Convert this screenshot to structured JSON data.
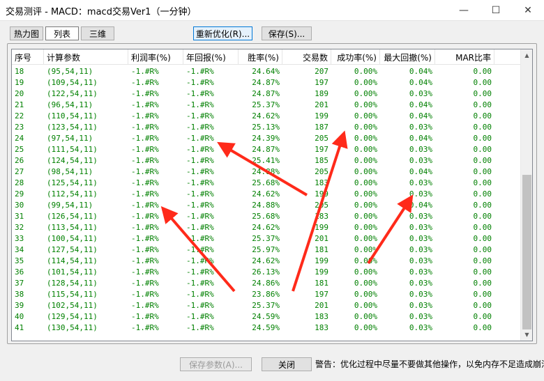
{
  "window": {
    "title": "交易测评 - MACD：macd交易Ver1（一分钟）"
  },
  "tabs": [
    "热力图",
    "列表",
    "三维"
  ],
  "toolbar": {
    "reoptimize_label": "重新优化(R)...",
    "save_label": "保存(S)..."
  },
  "table": {
    "headers": [
      "序号",
      "计算参数",
      "利润率(%)",
      "年回报(%)",
      "胜率(%)",
      "交易数",
      "成功率(%)",
      "最大回撤(%)",
      "MAR比率"
    ],
    "rows": [
      [
        "18",
        "(95,54,11)",
        "-1.#R%",
        "-1.#R%",
        "24.64%",
        "207",
        "0.00%",
        "0.04%",
        "0.00"
      ],
      [
        "19",
        "(109,54,11)",
        "-1.#R%",
        "-1.#R%",
        "24.87%",
        "197",
        "0.00%",
        "0.04%",
        "0.00"
      ],
      [
        "20",
        "(122,54,11)",
        "-1.#R%",
        "-1.#R%",
        "24.87%",
        "189",
        "0.00%",
        "0.03%",
        "0.00"
      ],
      [
        "21",
        "(96,54,11)",
        "-1.#R%",
        "-1.#R%",
        "25.37%",
        "201",
        "0.00%",
        "0.04%",
        "0.00"
      ],
      [
        "22",
        "(110,54,11)",
        "-1.#R%",
        "-1.#R%",
        "24.62%",
        "199",
        "0.00%",
        "0.04%",
        "0.00"
      ],
      [
        "23",
        "(123,54,11)",
        "-1.#R%",
        "-1.#R%",
        "25.13%",
        "187",
        "0.00%",
        "0.03%",
        "0.00"
      ],
      [
        "24",
        "(97,54,11)",
        "-1.#R%",
        "-1.#R%",
        "24.39%",
        "205",
        "0.00%",
        "0.04%",
        "0.00"
      ],
      [
        "25",
        "(111,54,11)",
        "-1.#R%",
        "-1.#R%",
        "24.87%",
        "197",
        "0.00%",
        "0.03%",
        "0.00"
      ],
      [
        "26",
        "(124,54,11)",
        "-1.#R%",
        "-1.#R%",
        "25.41%",
        "185",
        "0.00%",
        "0.03%",
        "0.00"
      ],
      [
        "27",
        "(98,54,11)",
        "-1.#R%",
        "-1.#R%",
        "24.88%",
        "205",
        "0.00%",
        "0.04%",
        "0.00"
      ],
      [
        "28",
        "(125,54,11)",
        "-1.#R%",
        "-1.#R%",
        "25.68%",
        "183",
        "0.00%",
        "0.03%",
        "0.00"
      ],
      [
        "29",
        "(112,54,11)",
        "-1.#R%",
        "-1.#R%",
        "24.62%",
        "199",
        "0.00%",
        "0.03%",
        "0.00"
      ],
      [
        "30",
        "(99,54,11)",
        "-1.#R%",
        "-1.#R%",
        "24.88%",
        "205",
        "0.00%",
        "0.04%",
        "0.00"
      ],
      [
        "31",
        "(126,54,11)",
        "-1.#R%",
        "-1.#R%",
        "25.68%",
        "183",
        "0.00%",
        "0.03%",
        "0.00"
      ],
      [
        "32",
        "(113,54,11)",
        "-1.#R%",
        "-1.#R%",
        "24.62%",
        "199",
        "0.00%",
        "0.03%",
        "0.00"
      ],
      [
        "33",
        "(100,54,11)",
        "-1.#R%",
        "-1.#R%",
        "25.37%",
        "201",
        "0.00%",
        "0.03%",
        "0.00"
      ],
      [
        "34",
        "(127,54,11)",
        "-1.#R%",
        "-1.#R%",
        "25.97%",
        "181",
        "0.00%",
        "0.03%",
        "0.00"
      ],
      [
        "35",
        "(114,54,11)",
        "-1.#R%",
        "-1.#R%",
        "24.62%",
        "199",
        "0.00%",
        "0.03%",
        "0.00"
      ],
      [
        "36",
        "(101,54,11)",
        "-1.#R%",
        "-1.#R%",
        "26.13%",
        "199",
        "0.00%",
        "0.03%",
        "0.00"
      ],
      [
        "37",
        "(128,54,11)",
        "-1.#R%",
        "-1.#R%",
        "24.86%",
        "181",
        "0.00%",
        "0.03%",
        "0.00"
      ],
      [
        "38",
        "(115,54,11)",
        "-1.#R%",
        "-1.#R%",
        "23.86%",
        "197",
        "0.00%",
        "0.03%",
        "0.00"
      ],
      [
        "39",
        "(102,54,11)",
        "-1.#R%",
        "-1.#R%",
        "25.37%",
        "201",
        "0.00%",
        "0.03%",
        "0.00"
      ],
      [
        "40",
        "(129,54,11)",
        "-1.#R%",
        "-1.#R%",
        "24.59%",
        "183",
        "0.00%",
        "0.03%",
        "0.00"
      ],
      [
        "41",
        "(130,54,11)",
        "-1.#R%",
        "-1.#R%",
        "24.59%",
        "183",
        "0.00%",
        "0.03%",
        "0.00"
      ]
    ]
  },
  "footer": {
    "save_params_label": "保存参数(A)...",
    "close_label": "关闭",
    "warning": "警告：优化过程中尽量不要做其他操作，以免内存不足造成崩溃"
  },
  "colors": {
    "row_text": "#008000",
    "arrow": "#ff2a1a"
  },
  "icons": [
    "minimize-icon",
    "maximize-icon",
    "close-icon",
    "scroll-up-icon",
    "scroll-down-icon",
    "red-arrow-icon"
  ]
}
